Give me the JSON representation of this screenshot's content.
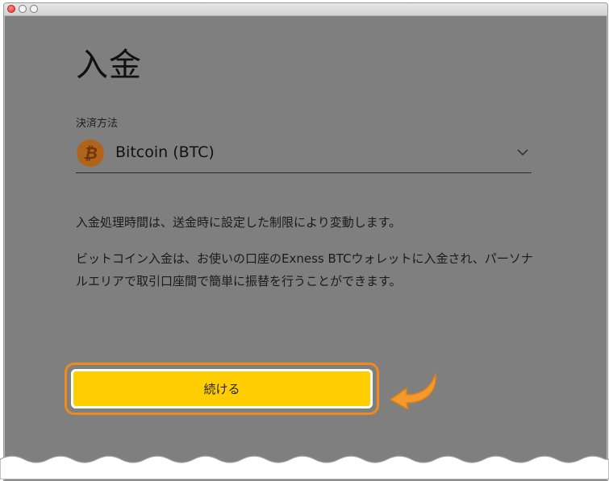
{
  "window": {
    "controls": [
      "close",
      "minimize",
      "zoom"
    ],
    "close_color": "#e0332a"
  },
  "page": {
    "title": "入金"
  },
  "payment_method": {
    "label": "決済方法",
    "selected": "Bitcoin (BTC)",
    "icon": "bitcoin-icon",
    "icon_color": "#b0641b"
  },
  "info": {
    "line1": "入金処理時間は、送金時に設定した制限により変動します。",
    "line2": "ビットコイン入金は、お使いの口座のExness BTCウォレットに入金され、パーソナルエリアで取引口座間で簡単に振替を行うことができます。"
  },
  "actions": {
    "continue_label": "続ける",
    "button_color": "#ffcd00",
    "highlight_color": "#f08a1c"
  }
}
